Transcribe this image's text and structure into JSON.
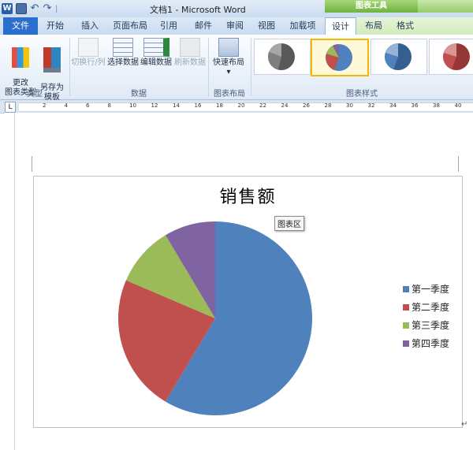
{
  "window": {
    "title": "文档1 - Microsoft Word",
    "context_tab": "图表工具",
    "logo": "W",
    "undo_icon": "↶",
    "redo_icon": "↷",
    "qat_separator": "|"
  },
  "tabs": [
    {
      "label": "文件"
    },
    {
      "label": "开始"
    },
    {
      "label": "插入"
    },
    {
      "label": "页面布局"
    },
    {
      "label": "引用"
    },
    {
      "label": "邮件"
    },
    {
      "label": "审阅"
    },
    {
      "label": "视图"
    },
    {
      "label": "加载项"
    },
    {
      "label": "设计"
    },
    {
      "label": "布局"
    },
    {
      "label": "格式"
    }
  ],
  "ribbon": {
    "type_group": {
      "label": "类型",
      "change_type": "更改\n图表类型",
      "save_template": "另存为\n模板"
    },
    "data_group": {
      "label": "数据",
      "switch_row_col": "切换行/列",
      "select_data": "选择数据",
      "edit_data": "编辑数据",
      "refresh_data": "刷新数据"
    },
    "layout_group": {
      "label": "图表布局",
      "quick_layout": "快速布局",
      "quick_layout_arrow": "▾"
    },
    "styles_group": {
      "label": "图表样式"
    }
  },
  "ruler": {
    "corner": "L",
    "ticks": [
      "2",
      "4",
      "6",
      "8",
      "10",
      "12",
      "14",
      "16",
      "18",
      "20",
      "22",
      "24",
      "26",
      "28",
      "30",
      "32",
      "34",
      "36",
      "38",
      "40"
    ]
  },
  "chart": {
    "tooltip": "图表区",
    "return_mark": "↵",
    "colors": [
      "#4f81bd",
      "#c0504d",
      "#9bbb59",
      "#8064a2"
    ]
  },
  "chart_data": {
    "type": "pie",
    "title": "销售额",
    "categories": [
      "第一季度",
      "第二季度",
      "第三季度",
      "第四季度"
    ],
    "values": [
      8.2,
      3.2,
      1.4,
      1.2
    ],
    "legend": "right"
  }
}
